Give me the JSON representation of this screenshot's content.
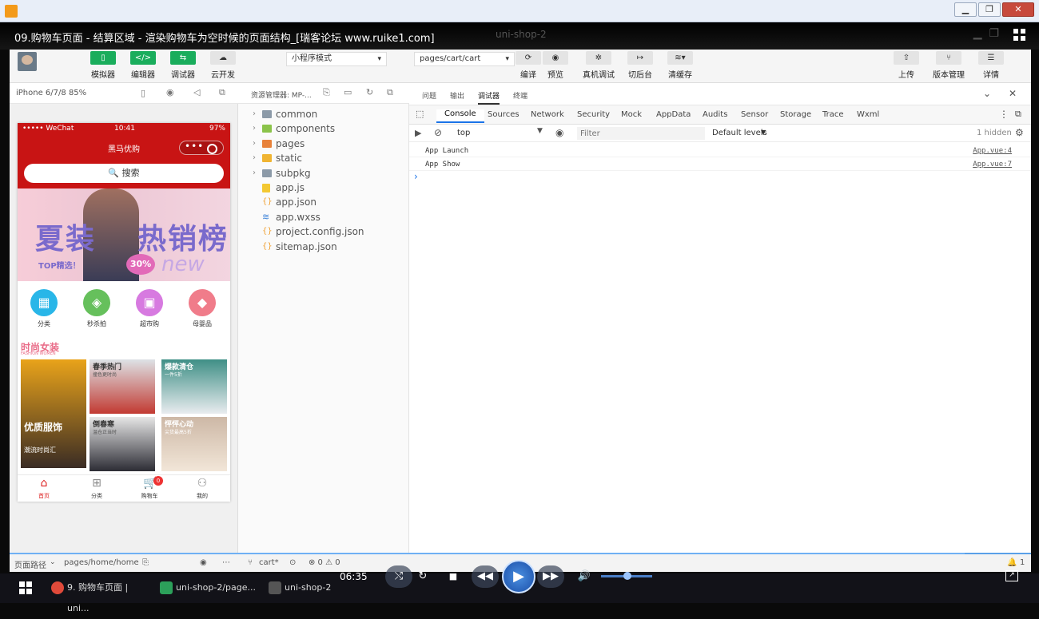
{
  "window": {
    "title_buttons": [
      "▁",
      "❐",
      "✕"
    ]
  },
  "video": {
    "title": "09.购物车页面 - 结算区域 - 渲染购物车为空时候的页面结构_[瑞客论坛 www.ruike1.com]",
    "ghost_title": "uni-shop-2",
    "time": "06:35"
  },
  "toolbar": {
    "simulator": "模拟器",
    "editor": "编辑器",
    "debugger": "调试器",
    "cloud": "云开发",
    "mode_select": "小程序模式",
    "page_select": "pages/cart/cart",
    "compile": "编译",
    "preview": "预览",
    "real_debug": "真机调试",
    "background": "切后台",
    "clear_cache": "清缓存",
    "upload": "上传",
    "version": "版本管理",
    "details": "详情"
  },
  "simulator": {
    "device": "iPhone 6/7/8 85%",
    "status_carrier": "••••• WeChat",
    "status_time": "10:41",
    "status_battery": "97%",
    "nav_title": "黑马优购",
    "search_label": "🔍 搜索",
    "banner": {
      "text1": "夏装",
      "text2": "热销榜",
      "top": "TOP精选！",
      "pct": "30%",
      "new": "new"
    },
    "categories": [
      {
        "label": "分类",
        "color": "#29b6e8",
        "icon": "grid-icon"
      },
      {
        "label": "秒杀拍",
        "color": "#66c05c",
        "icon": "hammer-icon"
      },
      {
        "label": "超市购",
        "color": "#d77ae0",
        "icon": "basket-icon"
      },
      {
        "label": "母婴品",
        "color": "#f07c8a",
        "icon": "tag-icon"
      }
    ],
    "floor_title": "时尚女装",
    "floor_subtitle": "FASHION WOMEN",
    "floor_items": [
      {
        "title": "优质服饰",
        "sub": "潮流时尚汇"
      },
      {
        "title": "春季热门",
        "sub": "撞色更时尚"
      },
      {
        "title": "爆款清仓",
        "sub": "一件5折"
      },
      {
        "title": "倒春寒",
        "sub": "温仓正当时"
      },
      {
        "title": "怦怦心动",
        "sub": "尖货最高5折"
      }
    ],
    "tabs": [
      {
        "label": "首页",
        "icon": "home-icon",
        "active": true
      },
      {
        "label": "分类",
        "icon": "grid-icon",
        "active": false
      },
      {
        "label": "购物车",
        "icon": "cart-icon",
        "active": false,
        "badge": "0"
      },
      {
        "label": "我的",
        "icon": "user-icon",
        "active": false
      }
    ]
  },
  "explorer": {
    "title": "资源管理器: MP-...",
    "items": [
      {
        "name": "common",
        "type": "folder",
        "color": "#8c9aa8"
      },
      {
        "name": "components",
        "type": "folder",
        "color": "#8bc34a"
      },
      {
        "name": "pages",
        "type": "folder",
        "color": "#e8823a"
      },
      {
        "name": "static",
        "type": "folder",
        "color": "#f0b432"
      },
      {
        "name": "subpkg",
        "type": "folder",
        "color": "#8c9aa8"
      },
      {
        "name": "app.js",
        "type": "file",
        "color": "#f3c832"
      },
      {
        "name": "app.json",
        "type": "file",
        "color": "#f0a032"
      },
      {
        "name": "app.wxss",
        "type": "file",
        "color": "#3b82d8"
      },
      {
        "name": "project.config.json",
        "type": "file",
        "color": "#f0a032"
      },
      {
        "name": "sitemap.json",
        "type": "file",
        "color": "#f0a032"
      }
    ]
  },
  "devtools": {
    "top_tabs": [
      "问题",
      "输出",
      "调试器",
      "终端"
    ],
    "tabs": [
      "Console",
      "Sources",
      "Network",
      "Security",
      "Mock",
      "AppData",
      "Audits",
      "Sensor",
      "Storage",
      "Trace",
      "Wxml"
    ],
    "context": "top",
    "filter_placeholder": "Filter",
    "levels": "Default levels",
    "hidden": "1 hidden",
    "logs": [
      {
        "msg": "App Launch",
        "src": "App.vue:4"
      },
      {
        "msg": "App Show",
        "src": "App.vue:7"
      }
    ],
    "prompt": "›"
  },
  "statusbar": {
    "path_label": "页面路径",
    "path": "pages/home/home",
    "branch": "cart*",
    "errors": "⊗ 0 ⚠ 0",
    "right": "1"
  },
  "taskbar": [
    {
      "label": "9. 购物车页面 | uni...",
      "color": "#e04a3a"
    },
    {
      "label": "uni-shop-2/page...",
      "color": "#2ca05a"
    },
    {
      "label": "uni-shop-2",
      "color": "#888888"
    }
  ]
}
